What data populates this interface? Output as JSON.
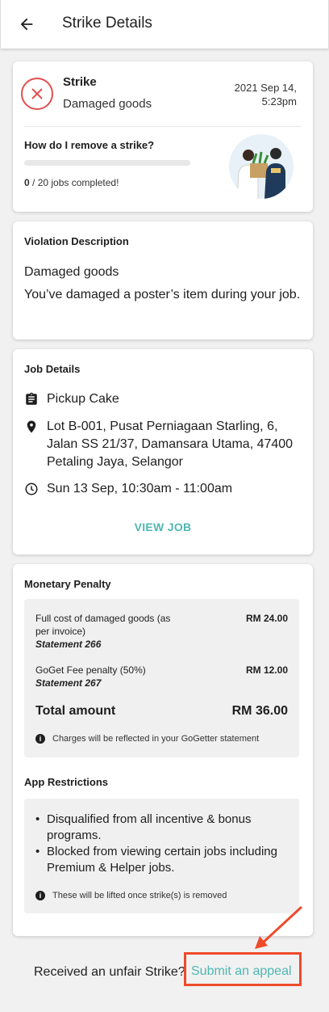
{
  "header": {
    "title": "Strike Details",
    "back_icon": "arrow-left-icon"
  },
  "strike": {
    "icon": "x-circle-icon",
    "title": "Strike",
    "reason": "Damaged goods",
    "date_line1": "2021 Sep 14,",
    "date_line2": "5:23pm",
    "remove_title": "How do I remove a strike?",
    "jobs_completed": "0",
    "jobs_total_text": " / 20 jobs completed!",
    "progress_fraction": 0
  },
  "violation": {
    "title": "Violation Description",
    "heading": "Damaged goods",
    "body": "You’ve damaged a poster’s item during your job."
  },
  "job": {
    "title": "Job Details",
    "name": "Pickup Cake",
    "address": "Lot B-001, Pusat Perniagaan Starling, 6, Jalan SS 21/37, Damansara Utama, 47400 Petaling Jaya, Selangor",
    "time": "Sun 13 Sep, 10:30am - 11:00am",
    "view_job": "VIEW JOB"
  },
  "penalty": {
    "title": "Monetary Penalty",
    "items": [
      {
        "label": "Full cost of damaged goods (as per invoice)",
        "statement": "Statement 266",
        "value": "RM 24.00"
      },
      {
        "label": "GoGet Fee penalty (50%)",
        "statement": "Statement 267",
        "value": "RM 12.00"
      }
    ],
    "total_label": "Total amount",
    "total_value": "RM 36.00",
    "note": "Charges will be reflected in your GoGetter statement"
  },
  "restrictions": {
    "title": "App Restrictions",
    "bullets": [
      "Disqualified from all incentive & bonus programs.",
      "Blocked from viewing certain jobs including Premium & Helper jobs."
    ],
    "note": "These will be lifted once strike(s) is removed"
  },
  "footer": {
    "text": "Received an unfair Strike?",
    "link": "Submit an appeal"
  },
  "colors": {
    "accent": "#4fb7b3",
    "error": "#e05050",
    "annotation": "#ee4b2b"
  }
}
